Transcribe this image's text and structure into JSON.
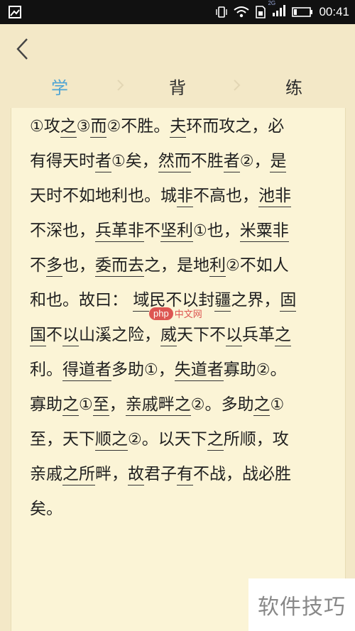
{
  "status_bar": {
    "time": "00:41",
    "network": "2G"
  },
  "tabs": [
    {
      "label": "学"
    },
    {
      "label": "背"
    },
    {
      "label": "练"
    }
  ],
  "poem": [
    [
      {
        "t": "①",
        "c": 1
      },
      {
        "t": "攻"
      },
      {
        "t": "之",
        "u": 1
      },
      {
        "t": "③",
        "c": 1
      },
      {
        "t": "而",
        "u": 1
      },
      {
        "t": "②",
        "c": 1
      },
      {
        "t": "不胜。"
      },
      {
        "t": "夫",
        "u": 1
      },
      {
        "t": "环而攻之，必"
      }
    ],
    [
      {
        "t": "有得天时"
      },
      {
        "t": "者",
        "u": 1
      },
      {
        "t": "①",
        "c": 1
      },
      {
        "t": "矣，"
      },
      {
        "t": "然而",
        "u": 1
      },
      {
        "t": "不胜"
      },
      {
        "t": "者",
        "u": 1
      },
      {
        "t": "②",
        "c": 1
      },
      {
        "t": "，"
      },
      {
        "t": "是",
        "u": 1
      }
    ],
    [
      {
        "t": "天时不如地利也。城"
      },
      {
        "t": "非",
        "u": 1
      },
      {
        "t": "不高也，"
      },
      {
        "t": "池",
        "u": 1
      },
      {
        "t": "非",
        "u": 1
      }
    ],
    [
      {
        "t": "不深也，"
      },
      {
        "t": "兵革",
        "u": 1
      },
      {
        "t": "非",
        "u": 1
      },
      {
        "t": "不"
      },
      {
        "t": "坚利",
        "u": 1
      },
      {
        "t": "①",
        "c": 1
      },
      {
        "t": "也，"
      },
      {
        "t": "米粟",
        "u": 1
      },
      {
        "t": "非",
        "u": 1
      }
    ],
    [
      {
        "t": "不"
      },
      {
        "t": "多",
        "u": 1
      },
      {
        "t": "也，"
      },
      {
        "t": "委",
        "u": 1
      },
      {
        "t": "而",
        "u": 1
      },
      {
        "t": "去",
        "u": 1
      },
      {
        "t": "之，是地"
      },
      {
        "t": "利",
        "u": 1
      },
      {
        "t": "②",
        "c": 1
      },
      {
        "t": "不如人"
      }
    ],
    [
      {
        "t": "和也。故曰：  "
      },
      {
        "t": "域",
        "u": 1
      },
      {
        "t": "民不以封"
      },
      {
        "t": "疆",
        "u": 1
      },
      {
        "t": "之界，"
      },
      {
        "t": "固",
        "u": 1
      }
    ],
    [
      {
        "t": "国",
        "u": 1
      },
      {
        "t": "不"
      },
      {
        "t": "以",
        "u": 1
      },
      {
        "t": "山溪之险，"
      },
      {
        "t": "威",
        "u": 1
      },
      {
        "t": "天下不"
      },
      {
        "t": "以",
        "u": 1
      },
      {
        "t": "兵革"
      },
      {
        "t": "之",
        "u": 1
      }
    ],
    [
      {
        "t": "利。"
      },
      {
        "t": "得道",
        "u": 1
      },
      {
        "t": "者",
        "u": 1
      },
      {
        "t": "多助"
      },
      {
        "t": "①",
        "c": 1
      },
      {
        "t": "，"
      },
      {
        "t": "失道",
        "u": 1
      },
      {
        "t": "者",
        "u": 1
      },
      {
        "t": "寡助"
      },
      {
        "t": "②",
        "c": 1
      },
      {
        "t": "。"
      }
    ],
    [
      {
        "t": "寡助"
      },
      {
        "t": "之",
        "u": 1
      },
      {
        "t": "①",
        "c": 1
      },
      {
        "t": "至",
        "u": 1
      },
      {
        "t": "，"
      },
      {
        "t": "亲戚",
        "u": 1
      },
      {
        "t": "畔",
        "u": 1
      },
      {
        "t": "之",
        "u": 1
      },
      {
        "t": "②",
        "c": 1
      },
      {
        "t": "。多助"
      },
      {
        "t": "之",
        "u": 1
      },
      {
        "t": "①",
        "c": 1
      }
    ],
    [
      {
        "t": "至，天下"
      },
      {
        "t": "顺",
        "u": 1
      },
      {
        "t": "之",
        "u": 1
      },
      {
        "t": "②",
        "c": 1
      },
      {
        "t": "。以天下"
      },
      {
        "t": "之",
        "u": 1
      },
      {
        "t": "所顺，攻"
      }
    ],
    [
      {
        "t": "亲戚"
      },
      {
        "t": "之",
        "u": 1
      },
      {
        "t": "所",
        "u": 1
      },
      {
        "t": "畔，"
      },
      {
        "t": "故",
        "u": 1
      },
      {
        "t": "君子"
      },
      {
        "t": "有",
        "u": 1
      },
      {
        "t": "不战，战必胜"
      }
    ],
    [
      {
        "t": "矣。"
      }
    ]
  ],
  "watermark": {
    "php": "php",
    "cn": "中文网"
  },
  "corner_text": "软件技巧"
}
